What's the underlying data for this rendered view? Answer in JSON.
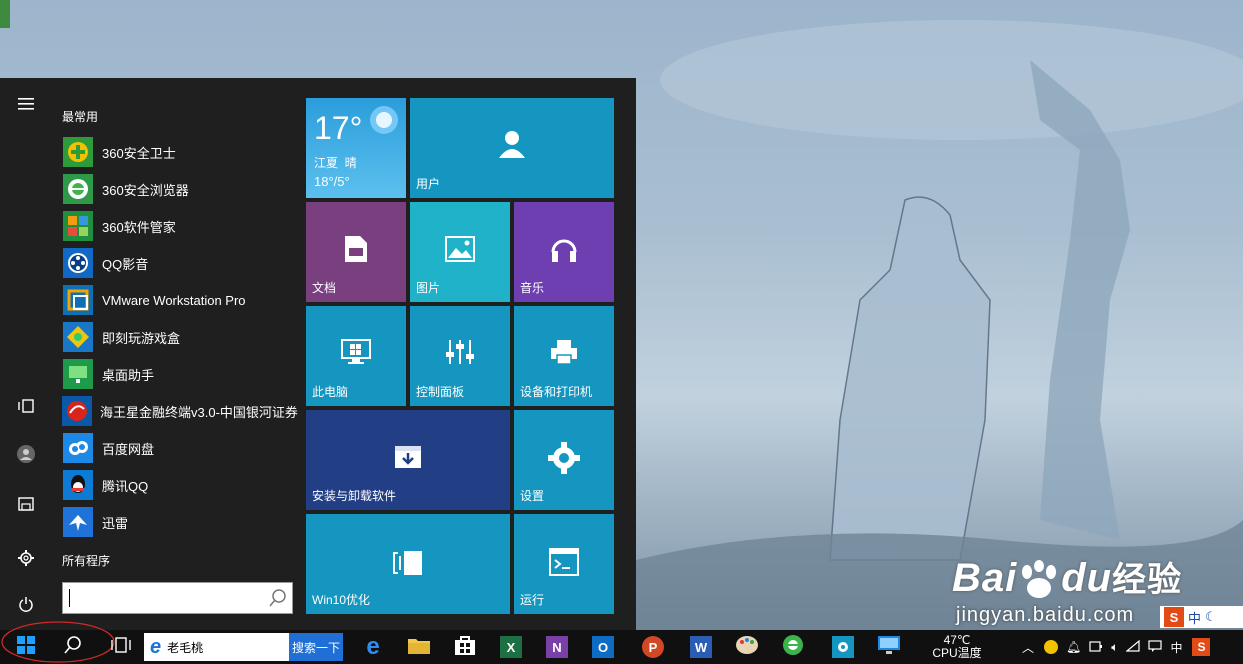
{
  "start_menu": {
    "most_used_heading": "最常用",
    "all_programs": "所有程序",
    "apps": [
      {
        "label": "360安全卫士",
        "icon": "360-safe-icon"
      },
      {
        "label": "360安全浏览器",
        "icon": "360-browser-icon"
      },
      {
        "label": "360软件管家",
        "icon": "360-software-manager-icon"
      },
      {
        "label": "QQ影音",
        "icon": "qq-player-icon"
      },
      {
        "label": "VMware Workstation Pro",
        "icon": "vmware-icon"
      },
      {
        "label": "即刻玩游戏盒",
        "icon": "game-box-icon"
      },
      {
        "label": "桌面助手",
        "icon": "desktop-assistant-icon"
      },
      {
        "label": "海王星金融终端v3.0-中国银河证券",
        "icon": "neptune-finance-icon"
      },
      {
        "label": "百度网盘",
        "icon": "baidu-netdisk-icon"
      },
      {
        "label": "腾讯QQ",
        "icon": "qq-icon"
      },
      {
        "label": "迅雷",
        "icon": "xunlei-icon"
      }
    ]
  },
  "tiles": {
    "weather": {
      "temp": "17°",
      "city": "江夏",
      "condition": "晴",
      "range": "18°/5°"
    },
    "user": "用户",
    "documents": "文档",
    "pictures": "图片",
    "music": "音乐",
    "this_pc": "此电脑",
    "control_panel": "控制面板",
    "devices_printers": "设备和打印机",
    "install_uninstall": "安装与卸载软件",
    "settings": "设置",
    "win10_optimize": "Win10优化",
    "run": "运行"
  },
  "taskbar": {
    "search_text": "老毛桃",
    "search_button": "搜索一下",
    "cpu_temp_value": "47℃",
    "cpu_temp_label": "CPU温度",
    "ime": "中"
  },
  "watermark": {
    "brand": "Bai",
    "brand2": "du",
    "brand_cn": "经验",
    "url": "jingyan.baidu.com",
    "ime_tray": "中"
  },
  "colors": {
    "tile_blue": "#1596c0",
    "tile_teal": "#1fb2c9",
    "tile_purple": "#7a3f7e",
    "tile_violet": "#6e3fb0",
    "tile_navy": "#223f86",
    "start_bg": "#1f1f1f"
  }
}
